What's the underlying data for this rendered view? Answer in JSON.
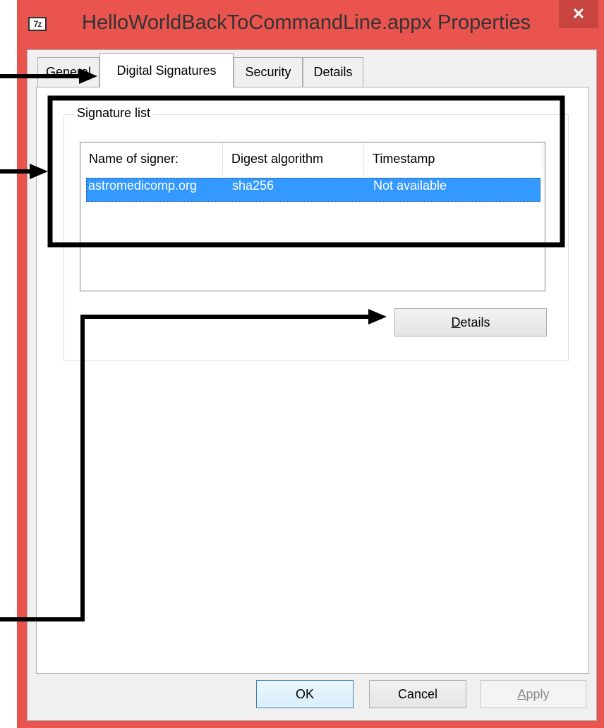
{
  "window": {
    "title": "HelloWorldBackToCommandLine.appx Properties",
    "icon_text": "7z",
    "close_symbol": "✕"
  },
  "tabs": [
    {
      "label": "General",
      "active": false
    },
    {
      "label": "Digital Signatures",
      "active": true
    },
    {
      "label": "Security",
      "active": false
    },
    {
      "label": "Details",
      "active": false
    }
  ],
  "signature_list": {
    "group_label": "Signature list",
    "columns": [
      "Name of signer:",
      "Digest algorithm",
      "Timestamp"
    ],
    "rows": [
      {
        "signer": "astromedicomp.org",
        "digest": "sha256",
        "timestamp": "Not available",
        "selected": true
      }
    ],
    "details_button": {
      "prefix": "",
      "accel": "D",
      "suffix": "etails"
    }
  },
  "footer": {
    "ok_label": "OK",
    "cancel_label": "Cancel",
    "apply_accel": "A",
    "apply_suffix": "pply",
    "apply_enabled": false
  },
  "colors": {
    "window_frame": "#e9544f",
    "selection": "#3399ff",
    "annotation": "#000000"
  }
}
